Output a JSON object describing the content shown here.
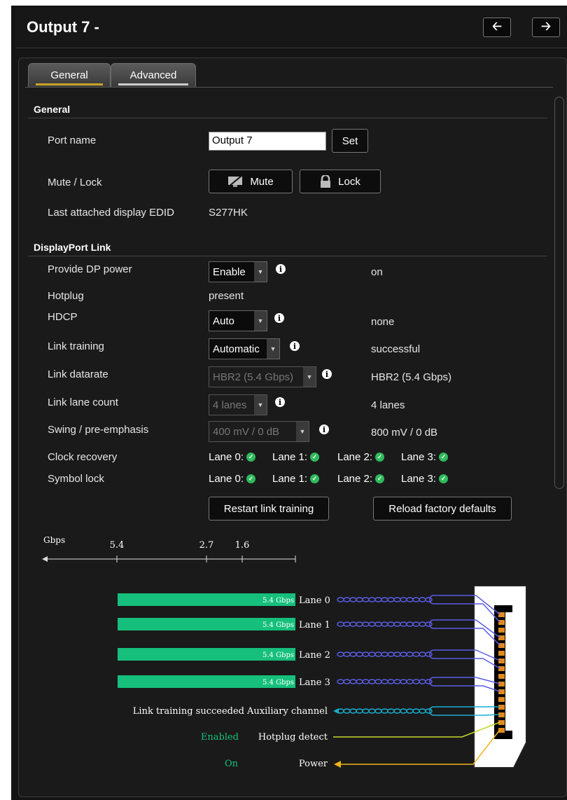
{
  "header": {
    "title": "Output 7 -",
    "back_icon": "arrow-left-icon",
    "forward_icon": "arrow-right-icon"
  },
  "tabs": [
    {
      "label": "General",
      "active": true,
      "underline": "#c9a227"
    },
    {
      "label": "Advanced",
      "active": false,
      "underline": "#cccccc"
    }
  ],
  "general": {
    "section_title": "General",
    "port_name_label": "Port name",
    "port_name_value": "Output 7",
    "set_label": "Set",
    "mute_lock_label": "Mute / Lock",
    "mute_label": "Mute",
    "lock_label": "Lock",
    "edid_label": "Last attached display EDID",
    "edid_value": "S277HK"
  },
  "dp": {
    "section_title": "DisplayPort Link",
    "rows": [
      {
        "label": "Provide DP power",
        "select": "Enable",
        "status": "on"
      },
      {
        "label": "Hotplug",
        "value": "present"
      },
      {
        "label": "HDCP",
        "select": "Auto",
        "status": "none"
      },
      {
        "label": "Link training",
        "select": "Automatic",
        "status": "successful"
      },
      {
        "label": "Link datarate",
        "select": "HBR2 (5.4 Gbps)",
        "status": "HBR2 (5.4 Gbps)"
      },
      {
        "label": "Link lane count",
        "select": "4 lanes",
        "status": "4 lanes"
      },
      {
        "label": "Swing / pre-emphasis",
        "select": "400 mV / 0 dB",
        "status": "800 mV / 0 dB"
      }
    ],
    "clock_label": "Clock recovery",
    "symbol_label": "Symbol lock",
    "lanes": [
      "Lane 0:",
      "Lane 1:",
      "Lane 2:",
      "Lane 3:"
    ],
    "restart_label": "Restart link training",
    "reload_label": "Reload factory defaults"
  },
  "diagram": {
    "axis_unit": "Gbps",
    "ticks": [
      "5.4",
      "2.7",
      "1.6"
    ],
    "bars": [
      {
        "text": "5.4 Gbps",
        "label": "Lane 0"
      },
      {
        "text": "5.4 Gbps",
        "label": "Lane 1"
      },
      {
        "text": "5.4 Gbps",
        "label": "Lane 2"
      },
      {
        "text": "5.4 Gbps",
        "label": "Lane 3"
      }
    ],
    "aux_status": "Link training succeeded",
    "aux_label": "Auxiliary channel",
    "hpd_status": "Enabled",
    "hpd_label": "Hotplug detect",
    "power_status": "On",
    "power_label": "Power",
    "colors": {
      "bar": "#16c07c",
      "lane_wire": "#5b5ce6",
      "aux_wire": "#1aaed0",
      "hpd_wire": "#c4d92a",
      "power_wire": "#f0b418",
      "status_green": "#16c07c"
    }
  }
}
